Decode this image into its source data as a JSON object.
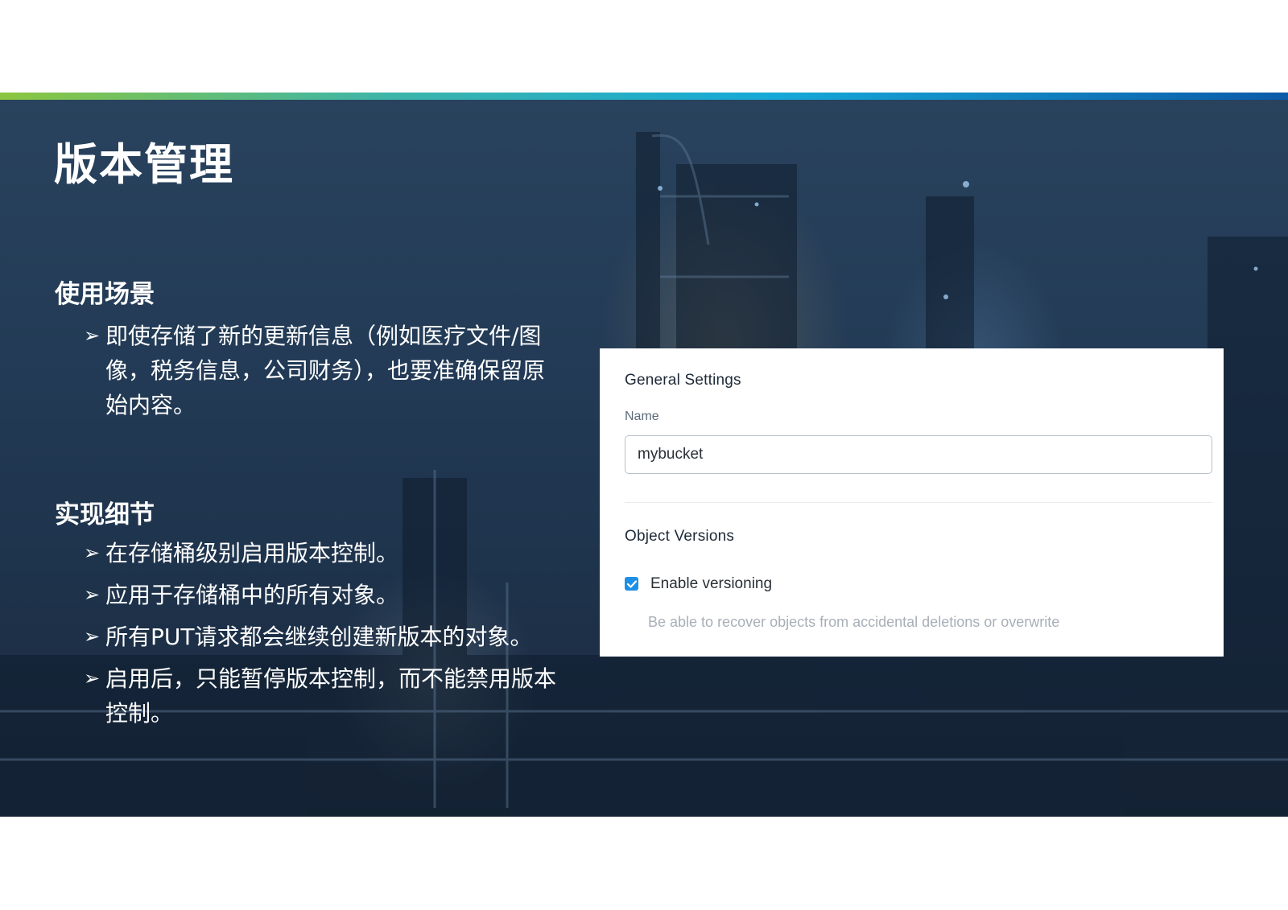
{
  "slide": {
    "title": "版本管理",
    "use_cases": {
      "heading": "使用场景",
      "items": [
        {
          "arrow": "➢",
          "text": "即使存储了新的更新信息（例如医疗文件/图像，税务信息，公司财务），也要准确保留原始内容。"
        }
      ]
    },
    "implementation": {
      "heading": "实现细节",
      "items": [
        {
          "arrow": "➢",
          "text": "在存储桶级别启用版本控制。"
        },
        {
          "arrow": "➢",
          "text": "应用于存储桶中的所有对象。"
        },
        {
          "arrow": "➢",
          "text": "所有PUT请求都会继续创建新版本的对象。"
        },
        {
          "arrow": "➢",
          "text": "启用后，只能暂停版本控制，而不能禁用版本控制。"
        }
      ]
    }
  },
  "settings_card": {
    "general_settings_title": "General Settings",
    "name_label": "Name",
    "name_value": "mybucket",
    "object_versions_title": "Object Versions",
    "versioning_checkbox": {
      "label": "Enable versioning",
      "checked": true
    },
    "versioning_help": "Be able to recover objects from accidental deletions or overwrite"
  },
  "colors": {
    "gradient_bar": [
      "#8cc63f",
      "#16a9d8",
      "#0b5aa8"
    ],
    "background_overlay": "#223a55",
    "checkbox_accent": "#1f8fe6"
  },
  "icons": {
    "bullet": "arrow-bullet-icon",
    "checkbox": "checkmark-icon"
  }
}
